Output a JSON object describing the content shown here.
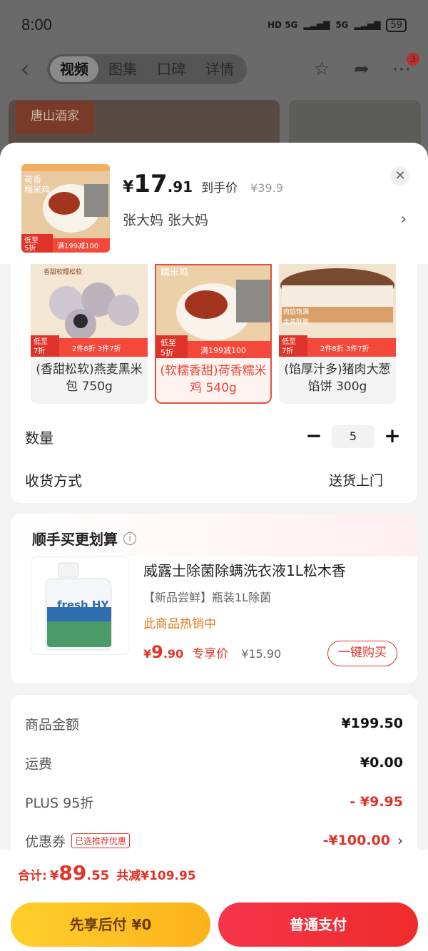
{
  "status": {
    "time": "8:00",
    "network1": "HD 5G",
    "network2": "5G",
    "battery": "59"
  },
  "nav": {
    "tabs": [
      "视频",
      "图集",
      "口碑",
      "详情"
    ],
    "active_tab": 0,
    "more_badge": "3"
  },
  "background": {
    "brand_logo": "唐山酒家"
  },
  "product": {
    "currency": "¥",
    "price_int": "17",
    "price_dec": ".91",
    "price_label": "到手价",
    "original_price": "¥39.9",
    "variant_text": "张大妈  张大妈",
    "thumb_title": "荷香\n糯米鸡",
    "thumb_badge": "低至\n5折",
    "thumb_promo": "满199减100"
  },
  "options": [
    {
      "label": "(香甜松软)燕麦黑米包 750g",
      "badge": "低至\n7折",
      "promo": "2件8折 3件7折",
      "top_text": "香甜软糯松软",
      "selected": false
    },
    {
      "label": "(软糯香甜)荷香糯米鸡 540g",
      "badge": "低至\n5折",
      "promo": "满199减100",
      "top_text": "荷香 糯米鸡",
      "selected": true
    },
    {
      "label": "(馅厚汁多)猪肉大葱馅饼 300g",
      "badge": "低至\n7折",
      "promo": "2件8折 3件7折",
      "top_text": "肉馅饱满 金黄酥脆",
      "selected": false
    }
  ],
  "quantity": {
    "label": "数量",
    "value": "5",
    "minus": "−",
    "plus": "+"
  },
  "shipping": {
    "label": "收货方式",
    "value": "送货上门"
  },
  "addon": {
    "title": "顺手买更划算",
    "name": "威露士除菌除螨洗衣液1L松木香",
    "sub": "【新品尝鲜】瓶装1L除菌",
    "hot": "此商品热销中",
    "price_cur": "¥",
    "price_int": "9",
    "price_dec": ".90",
    "price_label": "专享价",
    "old_price": "¥15.90",
    "buy_label": "一键购买",
    "bottle_brand": "fresh HY"
  },
  "summary": [
    {
      "label": "商品金额",
      "value": "¥199.50",
      "red": false
    },
    {
      "label": "运费",
      "value": "¥0.00",
      "red": false
    },
    {
      "label": "PLUS 95折",
      "value": "- ¥9.95",
      "red": true
    },
    {
      "label": "优惠券",
      "value": "-¥100.00",
      "red": true,
      "tag": "已选推荐优惠"
    }
  ],
  "total": {
    "label": "合计:",
    "cur": "¥",
    "int": "89",
    "dec": ".55",
    "save": "共减¥109.95"
  },
  "buttons": {
    "later": "先享后付 ¥0",
    "pay": "普通支付"
  },
  "colors": {
    "accent_red": "#e0342a",
    "orange": "#e07a1a",
    "yellow_btn": "#ffcf2a"
  }
}
